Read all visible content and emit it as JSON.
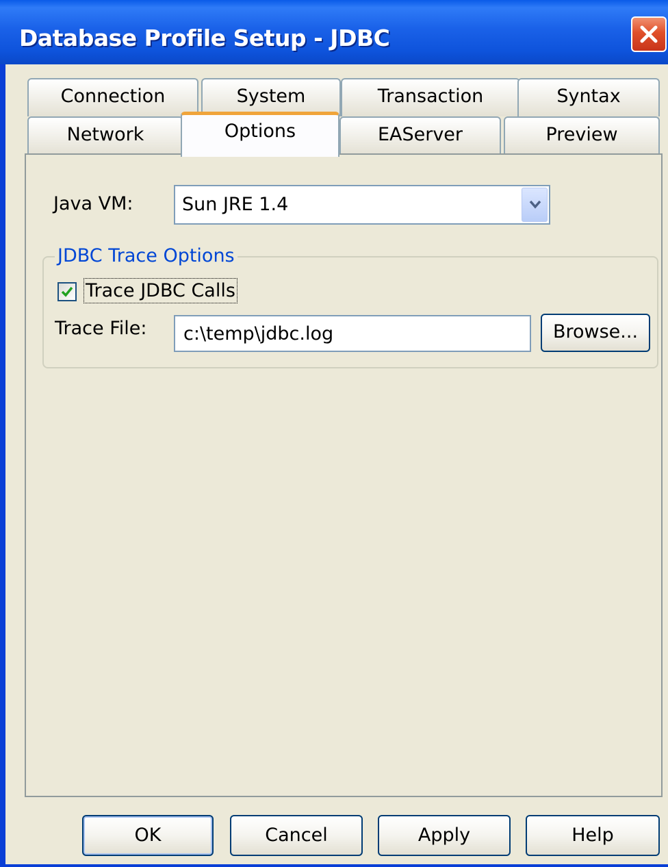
{
  "window": {
    "title": "Database Profile Setup - JDBC"
  },
  "tabs": {
    "row1": [
      "Connection",
      "System",
      "Transaction",
      "Syntax"
    ],
    "row2": [
      "Network",
      "Options",
      "EAServer",
      "Preview"
    ],
    "active": "Options"
  },
  "options": {
    "java_vm_label": "Java VM:",
    "java_vm_value": "Sun JRE 1.4",
    "group_title": "JDBC Trace Options",
    "trace_calls_label": "Trace JDBC Calls",
    "trace_calls_checked": true,
    "trace_file_label": "Trace File:",
    "trace_file_value": "c:\\temp\\jdbc.log",
    "browse_label": "Browse..."
  },
  "footer": {
    "ok_label": "OK",
    "cancel_label": "Cancel",
    "apply_label": "Apply",
    "help_label": "Help"
  },
  "colors": {
    "titlebar": "#0a5be8",
    "close": "#e0502a",
    "group_title": "#0046d5",
    "active_tab_accent": "#f0a43a",
    "checkmark": "#21a121"
  }
}
